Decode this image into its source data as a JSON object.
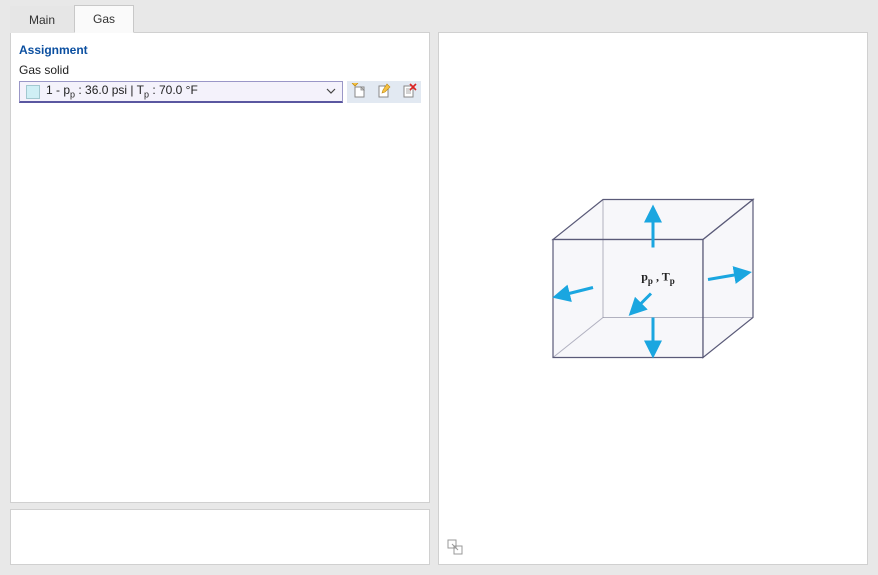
{
  "tabs": {
    "main": "Main",
    "gas": "Gas",
    "active": "gas"
  },
  "assignment": {
    "title": "Assignment",
    "field_label": "Gas solid",
    "dropdown_value": "1 - p<sub>p</sub> : 36.0 psi | T<sub>p</sub> : 70.0 °F"
  },
  "icons": {
    "new": "new-document",
    "edit": "edit-document",
    "delete": "delete-document",
    "link": "link-object"
  },
  "diagram": {
    "label": "p<sub>p</sub> , T<sub>p</sub>"
  }
}
